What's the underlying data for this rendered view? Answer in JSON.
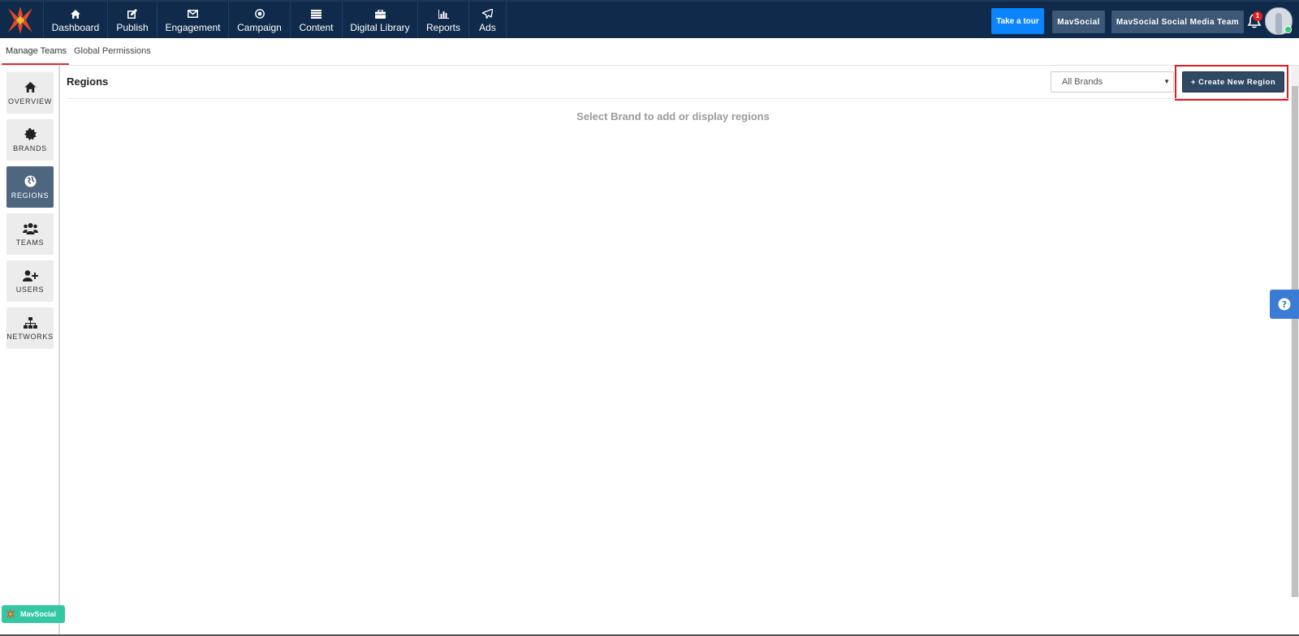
{
  "colors": {
    "nav_bg": "#0f2a4a",
    "tour_btn": "#0a84ff",
    "dark_btn": "#3d5876",
    "active_side": "#4f6680",
    "create_btn": "#2f4864",
    "highlight": "#e01b1b",
    "help_btn": "#3a7bd5",
    "footer_badge": "#34c7a3"
  },
  "nav": {
    "items": [
      {
        "label": "Dashboard",
        "icon": "home-icon"
      },
      {
        "label": "Publish",
        "icon": "edit-icon"
      },
      {
        "label": "Engagement",
        "icon": "envelope-icon"
      },
      {
        "label": "Campaign",
        "icon": "target-icon"
      },
      {
        "label": "Content",
        "icon": "list-icon"
      },
      {
        "label": "Digital Library",
        "icon": "briefcase-icon"
      },
      {
        "label": "Reports",
        "icon": "bar-chart-icon"
      },
      {
        "label": "Ads",
        "icon": "paper-plane-icon"
      }
    ],
    "take_tour": "Take a tour",
    "account_btn": "MavSocial",
    "team_btn": "MavSocial Social Media Team",
    "notification_count": "1"
  },
  "subnav": {
    "tabs": [
      "Manage Teams",
      "Global Permissions"
    ]
  },
  "sidebar": {
    "items": [
      {
        "label": "OVERVIEW",
        "icon": "home-icon"
      },
      {
        "label": "BRANDS",
        "icon": "badge-icon"
      },
      {
        "label": "REGIONS",
        "icon": "globe-icon",
        "active": true
      },
      {
        "label": "TEAMS",
        "icon": "users-icon"
      },
      {
        "label": "USERS",
        "icon": "user-plus-icon"
      },
      {
        "label": "NETWORKS",
        "icon": "sitemap-icon"
      }
    ]
  },
  "main": {
    "title": "Regions",
    "brand_select": "All Brands",
    "create_button": "+ Create New Region",
    "empty_message": "Select Brand to add or display regions"
  },
  "footer": {
    "badge_label": "MavSocial"
  }
}
